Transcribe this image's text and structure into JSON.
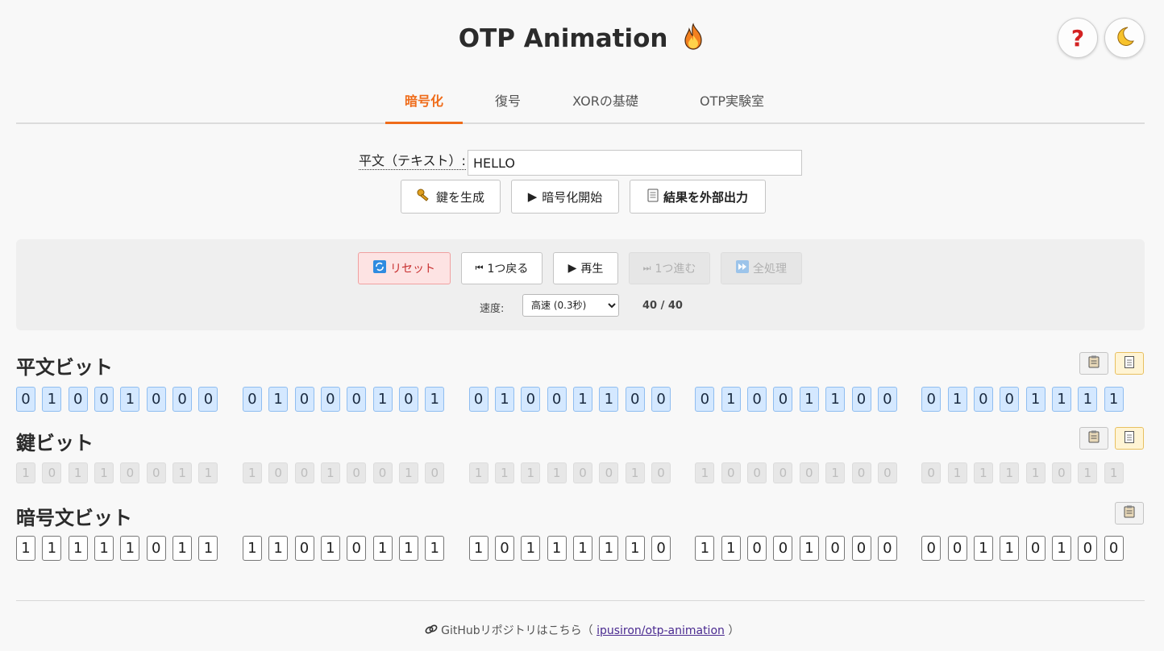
{
  "header": {
    "title": "OTP Animation",
    "flame_icon": "fire-icon"
  },
  "top_buttons": {
    "help_icon": "question-icon",
    "theme_icon": "moon-icon"
  },
  "tabs": [
    {
      "label": "暗号化",
      "active": true
    },
    {
      "label": "復号",
      "active": false
    },
    {
      "label": "XORの基礎",
      "active": false
    },
    {
      "label": "OTP実験室",
      "active": false
    }
  ],
  "input": {
    "label": "平文（テキスト）:",
    "value": "HELLO"
  },
  "actions": {
    "generate_key": "鍵を生成",
    "start_encrypt": "暗号化開始",
    "export": "結果を外部出力"
  },
  "controls": {
    "reset": "リセット",
    "back": "1つ戻る",
    "play": "再生",
    "forward": "1つ進む",
    "all": "全処理",
    "speed_label": "速度:",
    "speed_value": "高速 (0.3秒)",
    "progress": "40 / 40"
  },
  "sections": {
    "plaintext": {
      "title": "平文ビット",
      "groups": [
        [
          0,
          1,
          0,
          0,
          1,
          0,
          0,
          0
        ],
        [
          0,
          1,
          0,
          0,
          0,
          1,
          0,
          1
        ],
        [
          0,
          1,
          0,
          0,
          1,
          1,
          0,
          0
        ],
        [
          0,
          1,
          0,
          0,
          1,
          1,
          0,
          0
        ],
        [
          0,
          1,
          0,
          0,
          1,
          1,
          1,
          1
        ]
      ]
    },
    "key": {
      "title": "鍵ビット",
      "groups": [
        [
          1,
          0,
          1,
          1,
          0,
          0,
          1,
          1
        ],
        [
          1,
          0,
          0,
          1,
          0,
          0,
          1,
          0
        ],
        [
          1,
          1,
          1,
          1,
          0,
          0,
          1,
          0
        ],
        [
          1,
          0,
          0,
          0,
          0,
          1,
          0,
          0
        ],
        [
          0,
          1,
          1,
          1,
          1,
          0,
          1,
          1
        ]
      ]
    },
    "ciphertext": {
      "title": "暗号文ビット",
      "groups": [
        [
          1,
          1,
          1,
          1,
          1,
          0,
          1,
          1
        ],
        [
          1,
          1,
          0,
          1,
          0,
          1,
          1,
          1
        ],
        [
          1,
          0,
          1,
          1,
          1,
          1,
          1,
          0
        ],
        [
          1,
          1,
          0,
          0,
          1,
          0,
          0,
          0
        ],
        [
          0,
          0,
          1,
          1,
          0,
          1,
          0,
          0
        ]
      ]
    }
  },
  "footer": {
    "text": "GitHubリポジトリはこちら（",
    "link": "ipusiron/otp-animation",
    "close": "）"
  },
  "colors": {
    "accent": "#ef6c1a",
    "plain_bit_bg": "#d4e8ff",
    "reset_bg": "#fde3e3"
  }
}
